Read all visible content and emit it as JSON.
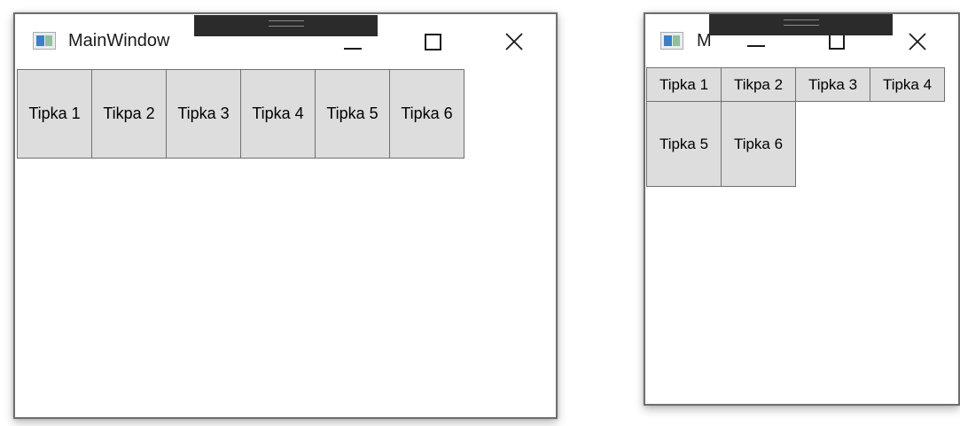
{
  "window_left": {
    "title": "MainWindow",
    "buttons": [
      "Tipka 1",
      "Tikpa 2",
      "Tipka 3",
      "Tipka 4",
      "Tipka 5",
      "Tipka 6"
    ]
  },
  "window_right": {
    "title": "M",
    "buttons": [
      "Tipka 1",
      "Tikpa 2",
      "Tipka 3",
      "Tipka 4",
      "Tipka 5",
      "Tipka 6"
    ]
  },
  "icons": {
    "app": "app-window-icon",
    "minimize": "minimize-icon",
    "maximize": "maximize-icon",
    "close": "close-icon",
    "snap": "snap-layout-bar"
  },
  "colors": {
    "button_bg": "#dddddd",
    "button_border": "#707070",
    "window_border": "#6e6e6e",
    "snap_bar": "#2b2b2b"
  }
}
